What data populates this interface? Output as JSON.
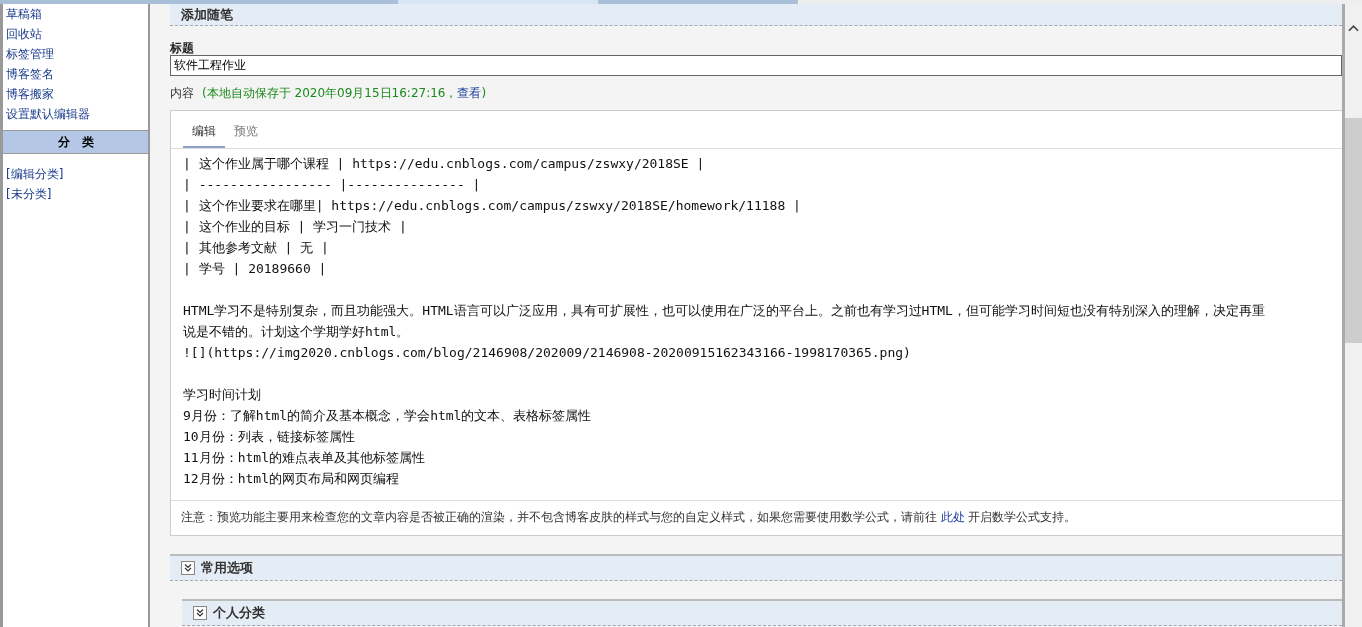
{
  "sidebar": {
    "items": [
      {
        "label": "草稿箱"
      },
      {
        "label": "回收站"
      },
      {
        "label": "标签管理"
      },
      {
        "label": "博客签名"
      },
      {
        "label": "博客搬家"
      },
      {
        "label": "设置默认编辑器"
      }
    ],
    "category_header": "分　类",
    "category_links": [
      {
        "label": "[编辑分类]"
      },
      {
        "label": "[未分类]"
      }
    ]
  },
  "section_title": "添加随笔",
  "title_field": {
    "label": "标题",
    "value": "软件工程作业"
  },
  "content_label": "内容",
  "autosave": {
    "text": "(本地自动保存于 2020年09月15日16:27:16，",
    "link": "查看",
    "close": ")"
  },
  "editor": {
    "tabs": [
      {
        "label": "编辑",
        "selected": true
      },
      {
        "label": "预览",
        "selected": false
      }
    ],
    "blocks": [
      [
        "| 这个作业属于哪个课程 | https://edu.cnblogs.com/campus/zswxy/2018SE |",
        "| ----------------- |--------------- |",
        "| 这个作业要求在哪里| https://edu.cnblogs.com/campus/zswxy/2018SE/homework/11188 |",
        "| 这个作业的目标 | 学习一门技术 |",
        "| 其他参考文献 | 无 |",
        "| 学号 | 20189660 |"
      ],
      [
        "HTML学习不是特别复杂，而且功能强大。HTML语言可以广泛应用，具有可扩展性，也可以使用在广泛的平台上。之前也有学习过HTML，但可能学习时间短也没有特别深入的理解，决定再重",
        "说是不错的。计划这个学期学好html。",
        "![](https://img2020.cnblogs.com/blog/2146908/202009/2146908-20200915162343166-1998170365.png)"
      ],
      [
        "学习时间计划",
        "9月份：了解html的简介及基本概念，学会html的文本、表格标签属性",
        "10月份：列表，链接标签属性",
        "11月份：html的难点表单及其他标签属性",
        "12月份：html的网页布局和网页编程"
      ]
    ],
    "note": {
      "before": "注意：预览功能主要用来检查您的文章内容是否被正确的渲染，并不包含博客皮肤的样式与您的自定义样式，如果您需要使用数学公式，请前往 ",
      "link": "此处",
      "after": " 开启数学公式支持。"
    }
  },
  "sections": [
    {
      "label": "常用选项",
      "expanded": false,
      "nested": false
    },
    {
      "label": "个人分类",
      "expanded": false,
      "nested": true
    }
  ]
}
